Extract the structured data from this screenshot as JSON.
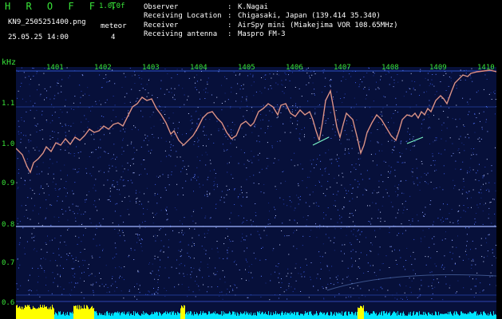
{
  "header": {
    "title": "H R O F F T",
    "version": "1.0.0f",
    "filename": "KN9_2505251400.png",
    "timestamp": "25.05.25 14:00",
    "meteor_label": "meteor",
    "meteor_count": "4"
  },
  "info": [
    {
      "key": "Observer",
      "value": "K.Nagai"
    },
    {
      "key": "Receiving Location",
      "value": "Chigasaki, Japan (139.414 35.340)"
    },
    {
      "key": "Receiver",
      "value": "AirSpy mini (Miakejima VOR 108.65MHz)"
    },
    {
      "key": "Receiving antenna",
      "value": "Maspro FM-3"
    }
  ],
  "axis": {
    "unit": "kHz",
    "time_ticks": [
      "1401",
      "1402",
      "1403",
      "1404",
      "1405",
      "1406",
      "1407",
      "1408",
      "1409",
      "1410"
    ],
    "freq_ticks": [
      "1.1",
      "1.0",
      "0.9",
      "0.8",
      "0.7",
      "0.6"
    ]
  },
  "colors": {
    "label_green": "#39e639",
    "background": "#07103a",
    "trace": "#ff6b6b",
    "signal_bars": "#ffff00",
    "noise_floor": "#00e5ff"
  }
}
